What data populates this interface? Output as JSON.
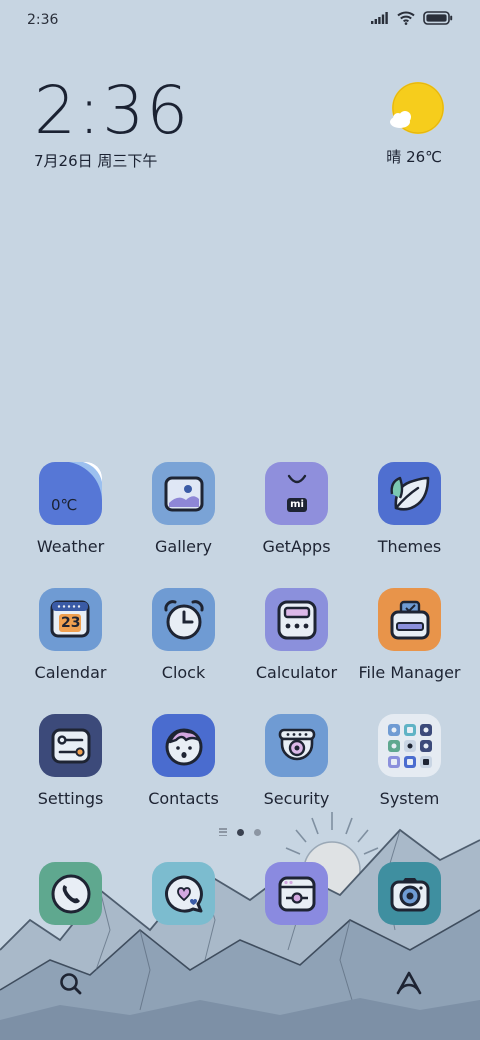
{
  "status_bar": {
    "time": "2:36"
  },
  "clock_widget": {
    "time": "2:36",
    "date": "7月26日 周三下午"
  },
  "weather_widget": {
    "text": "晴 26℃"
  },
  "apps": [
    {
      "name": "Weather",
      "badge": "0℃"
    },
    {
      "name": "Gallery"
    },
    {
      "name": "GetApps",
      "badge": "mi"
    },
    {
      "name": "Themes"
    },
    {
      "name": "Calendar",
      "badge": "23"
    },
    {
      "name": "Clock"
    },
    {
      "name": "Calculator"
    },
    {
      "name": "File Manager"
    },
    {
      "name": "Settings"
    },
    {
      "name": "Contacts"
    },
    {
      "name": "Security"
    },
    {
      "name": "System"
    }
  ],
  "dock": [
    {
      "icon": "phone-icon"
    },
    {
      "icon": "messages-icon"
    },
    {
      "icon": "browser-icon"
    },
    {
      "icon": "camera-icon"
    }
  ],
  "page_indicator": {
    "pages": 2,
    "current": 1
  },
  "colors": {
    "background": "#c7d5e2",
    "weather": "#5677d6",
    "gallery": "#7aa3d6",
    "getapps": "#8f8fdc",
    "themes": "#4f6fd0",
    "calendar": "#6f9bd3",
    "clock": "#6f9bd3",
    "calculator": "#8b90dc",
    "filemanager": "#e8944a",
    "settings": "#3c4a7a",
    "contacts": "#4a6ccf",
    "security": "#6f9bd3",
    "system": "#e5ebf2",
    "phone": "#5fa88f",
    "messages": "#7cbccf",
    "browser": "#8a8ae0",
    "camera": "#3f8fa0"
  }
}
